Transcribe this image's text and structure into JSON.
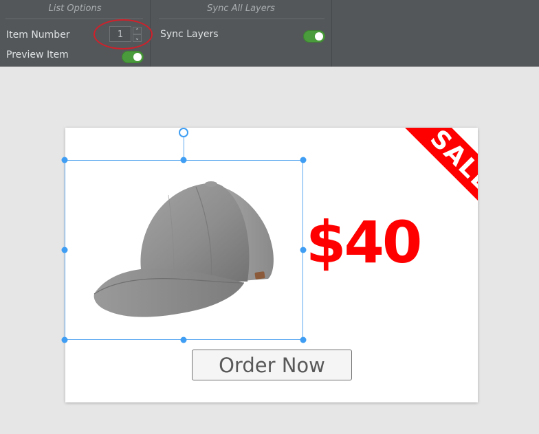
{
  "list_options": {
    "title": "List Options",
    "item_number_label": "Item Number",
    "item_number_value": "1",
    "preview_item_label": "Preview Item",
    "preview_item_on": true
  },
  "sync_all_layers": {
    "title": "Sync All Layers",
    "sync_layers_label": "Sync Layers",
    "sync_layers_on": true
  },
  "ad": {
    "sale_text": "SALE",
    "price": "$40",
    "order_button_label": "Order Now"
  },
  "colors": {
    "panel_bg": "#53575a",
    "toggle_on": "#4a9b3c",
    "sale_red": "#ff0000",
    "selection_blue": "#3f9ef3",
    "annotation_red": "#d0202a"
  },
  "icons": {
    "spinner_up": "chevron-up-icon",
    "spinner_down": "chevron-down-icon"
  }
}
